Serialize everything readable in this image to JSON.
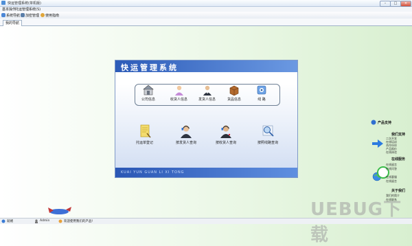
{
  "window": {
    "title": "快运管理系统(单机版)"
  },
  "menu": [
    "基本操作",
    "托运管理",
    "系统(S)"
  ],
  "toolbar": {
    "buttons": [
      "系统导航",
      "加密管理",
      "使用指南"
    ]
  },
  "tabs": [
    "我的导航"
  ],
  "panel": {
    "title": "快运管理系统",
    "pinyin": "KUAI YUN GUAN LI XI TONG",
    "top_items": [
      {
        "label": "公司信息",
        "icon": "building-icon"
      },
      {
        "label": "收货人信息",
        "icon": "receiver-person-icon"
      },
      {
        "label": "发货人信息",
        "icon": "sender-person-icon"
      },
      {
        "label": "货品信息",
        "icon": "package-icon"
      },
      {
        "label": "线 路",
        "icon": "route-icon"
      }
    ],
    "bottom_items": [
      {
        "label": "托运单登记",
        "icon": "form-icon"
      },
      {
        "label": "按发货人查询",
        "icon": "sender-query-icon"
      },
      {
        "label": "按收货人查询",
        "icon": "receiver-query-icon"
      },
      {
        "label": "按照线路查询",
        "icon": "route-search-icon"
      }
    ]
  },
  "sidebar": {
    "title": "产品支持",
    "sections": [
      {
        "title": "我们支持",
        "links": [
          "二次开发",
          "在线培训",
          "合作伙伴",
          "产品报价",
          "在线体验"
        ]
      },
      {
        "title": "在线服务",
        "links": [
          "在线留言",
          "在线问答",
          "在线客服",
          "在线留言"
        ]
      },
      {
        "title": "关于我们",
        "links": [
          "我们的简介",
          "在线联系"
        ]
      }
    ]
  },
  "status": {
    "ready": "就绪",
    "user": "Admin",
    "welcome": "欢迎使用我们的产品!"
  },
  "watermark": "UEBUG下载"
}
